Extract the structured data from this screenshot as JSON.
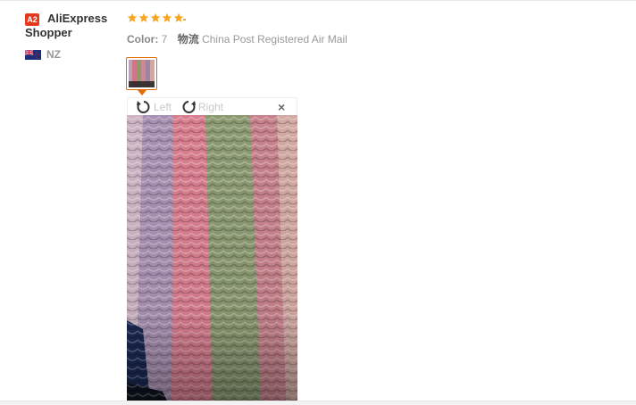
{
  "review": {
    "user": {
      "badge": "A2",
      "name": "AliExpress Shopper",
      "country": "NZ",
      "flag_icon": "nz-flag-icon"
    },
    "rating": 5,
    "star_color": "#f5a623",
    "color_label": "Color:",
    "color_value": "7",
    "shipping_label": "物流",
    "shipping_value": "China Post Registered Air Mail",
    "photo_viewer": {
      "rotate_left_label": "Left",
      "rotate_right_label": "Right",
      "close_symbol": "×"
    }
  },
  "colors": {
    "accent": "#e46c00",
    "badge": "#e4391d"
  }
}
